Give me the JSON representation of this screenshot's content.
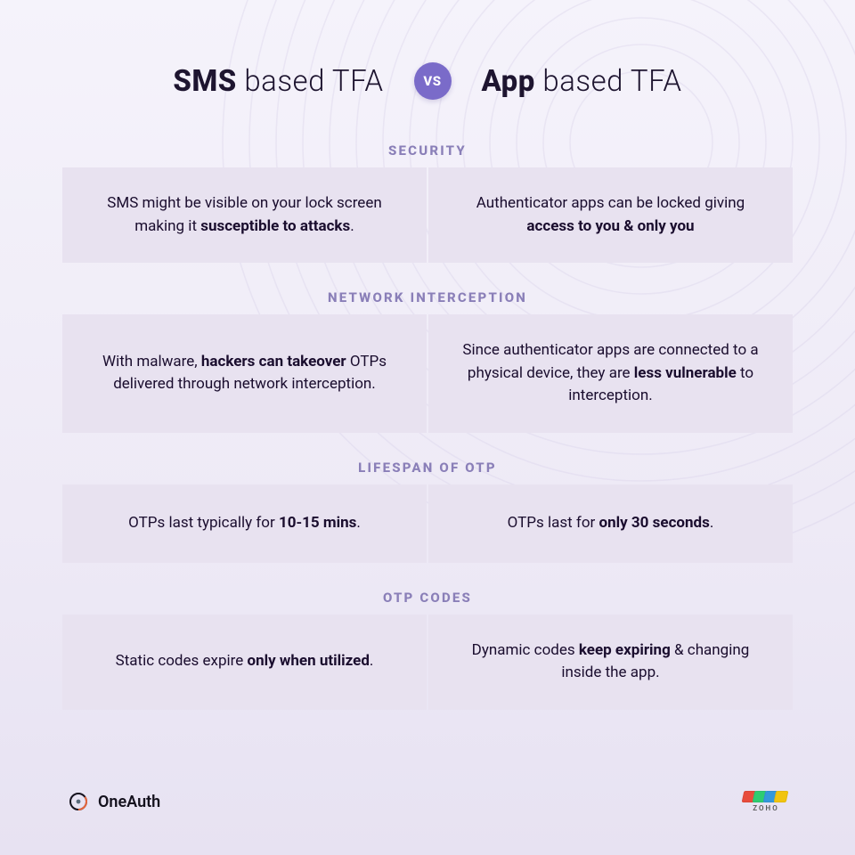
{
  "header": {
    "left_bold": "SMS",
    "left_rest": " based TFA",
    "vs": "VS",
    "right_bold": "App",
    "right_rest": " based TFA"
  },
  "sections": [
    {
      "label": "SECURITY",
      "left_pre": "SMS might be visible on your lock screen making it ",
      "left_bold": "susceptible to attacks",
      "left_post": ".",
      "right_pre": "Authenticator apps can be locked giving ",
      "right_bold": "access to you & only you",
      "right_post": ""
    },
    {
      "label": "NETWORK INTERCEPTION",
      "left_pre": "With malware, ",
      "left_bold": "hackers can takeover",
      "left_post": " OTPs delivered through network interception.",
      "right_pre": "Since authenticator apps are connected to a physical device, they are ",
      "right_bold": "less vulnerable",
      "right_post": " to interception."
    },
    {
      "label": "LIFESPAN OF OTP",
      "left_pre": "OTPs last typically for ",
      "left_bold": "10-15 mins",
      "left_post": ".",
      "right_pre": "OTPs last for ",
      "right_bold": "only 30 seconds",
      "right_post": "."
    },
    {
      "label": "OTP CODES",
      "left_pre": "Static codes expire ",
      "left_bold": "only when utilized",
      "left_post": ".",
      "right_pre": "Dynamic codes ",
      "right_bold": "keep expiring",
      "right_post": " & changing inside the app."
    }
  ],
  "footer": {
    "oneauth": "OneAuth",
    "zoho": "ZOHO"
  }
}
